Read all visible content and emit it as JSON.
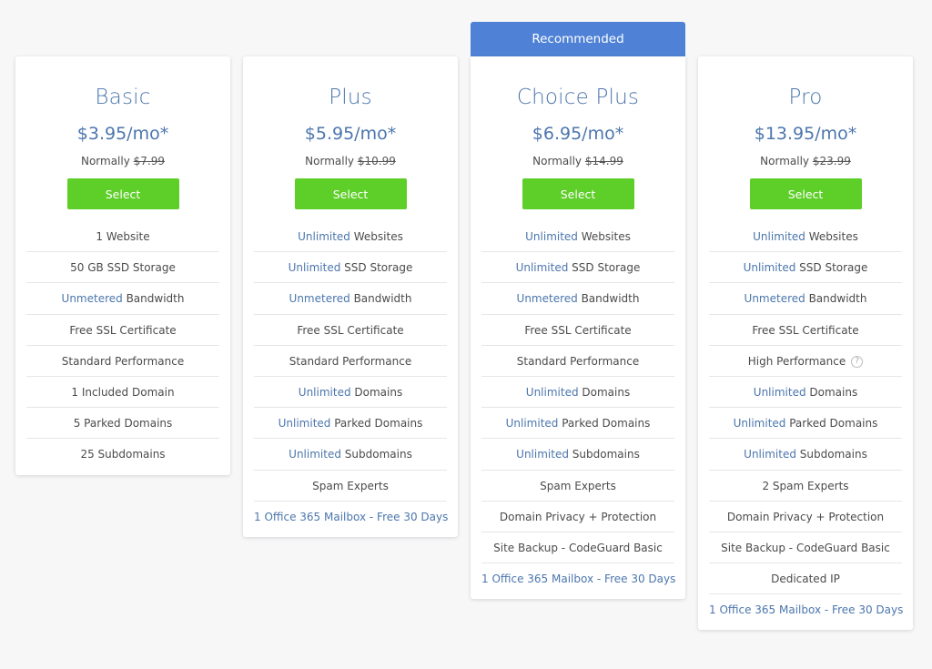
{
  "recommended_label": "Recommended",
  "select_label": "Select",
  "normally_label": "Normally",
  "colors": {
    "accent": "#4c76ad",
    "button": "#5ece29",
    "ribbon": "#4f82d6"
  },
  "plans": [
    {
      "name": "Basic",
      "price": "$3.95/mo*",
      "normal_price": "$7.99",
      "features": [
        {
          "hl": "",
          "text": "1 Website"
        },
        {
          "hl": "",
          "text": "50 GB SSD Storage"
        },
        {
          "hl": "Unmetered",
          "text": " Bandwidth"
        },
        {
          "hl": "",
          "text": "Free SSL Certificate"
        },
        {
          "hl": "",
          "text": "Standard Performance"
        },
        {
          "hl": "",
          "text": "1 Included Domain"
        },
        {
          "hl": "",
          "text": "5 Parked Domains"
        },
        {
          "hl": "",
          "text": "25 Subdomains"
        }
      ]
    },
    {
      "name": "Plus",
      "price": "$5.95/mo*",
      "normal_price": "$10.99",
      "features": [
        {
          "hl": "Unlimited",
          "text": " Websites"
        },
        {
          "hl": "Unlimited",
          "text": " SSD Storage"
        },
        {
          "hl": "Unmetered",
          "text": " Bandwidth"
        },
        {
          "hl": "",
          "text": "Free SSL Certificate"
        },
        {
          "hl": "",
          "text": "Standard Performance"
        },
        {
          "hl": "Unlimited",
          "text": " Domains"
        },
        {
          "hl": "Unlimited",
          "text": " Parked Domains"
        },
        {
          "hl": "Unlimited",
          "text": " Subdomains"
        },
        {
          "hl": "",
          "text": "Spam Experts"
        },
        {
          "link": "1 Office 365 Mailbox - Free 30 Days"
        }
      ]
    },
    {
      "name": "Choice Plus",
      "price": "$6.95/mo*",
      "normal_price": "$14.99",
      "features": [
        {
          "hl": "Unlimited",
          "text": " Websites"
        },
        {
          "hl": "Unlimited",
          "text": " SSD Storage"
        },
        {
          "hl": "Unmetered",
          "text": " Bandwidth"
        },
        {
          "hl": "",
          "text": "Free SSL Certificate"
        },
        {
          "hl": "",
          "text": "Standard Performance"
        },
        {
          "hl": "Unlimited",
          "text": " Domains"
        },
        {
          "hl": "Unlimited",
          "text": " Parked Domains"
        },
        {
          "hl": "Unlimited",
          "text": " Subdomains"
        },
        {
          "hl": "",
          "text": "Spam Experts"
        },
        {
          "hl": "",
          "text": "Domain Privacy + Protection"
        },
        {
          "hl": "",
          "text": "Site Backup - CodeGuard Basic"
        },
        {
          "link": "1 Office 365 Mailbox - Free 30 Days"
        }
      ]
    },
    {
      "name": "Pro",
      "price": "$13.95/mo*",
      "normal_price": "$23.99",
      "features": [
        {
          "hl": "Unlimited",
          "text": " Websites"
        },
        {
          "hl": "Unlimited",
          "text": " SSD Storage"
        },
        {
          "hl": "Unmetered",
          "text": " Bandwidth"
        },
        {
          "hl": "",
          "text": "Free SSL Certificate"
        },
        {
          "hl": "",
          "text": "High Performance",
          "help": "?"
        },
        {
          "hl": "Unlimited",
          "text": " Domains"
        },
        {
          "hl": "Unlimited",
          "text": " Parked Domains"
        },
        {
          "hl": "Unlimited",
          "text": " Subdomains"
        },
        {
          "hl": "",
          "text": "2 Spam Experts"
        },
        {
          "hl": "",
          "text": "Domain Privacy + Protection"
        },
        {
          "hl": "",
          "text": "Site Backup - CodeGuard Basic"
        },
        {
          "hl": "",
          "text": "Dedicated IP"
        },
        {
          "link": "1 Office 365 Mailbox - Free 30 Days"
        }
      ]
    }
  ]
}
